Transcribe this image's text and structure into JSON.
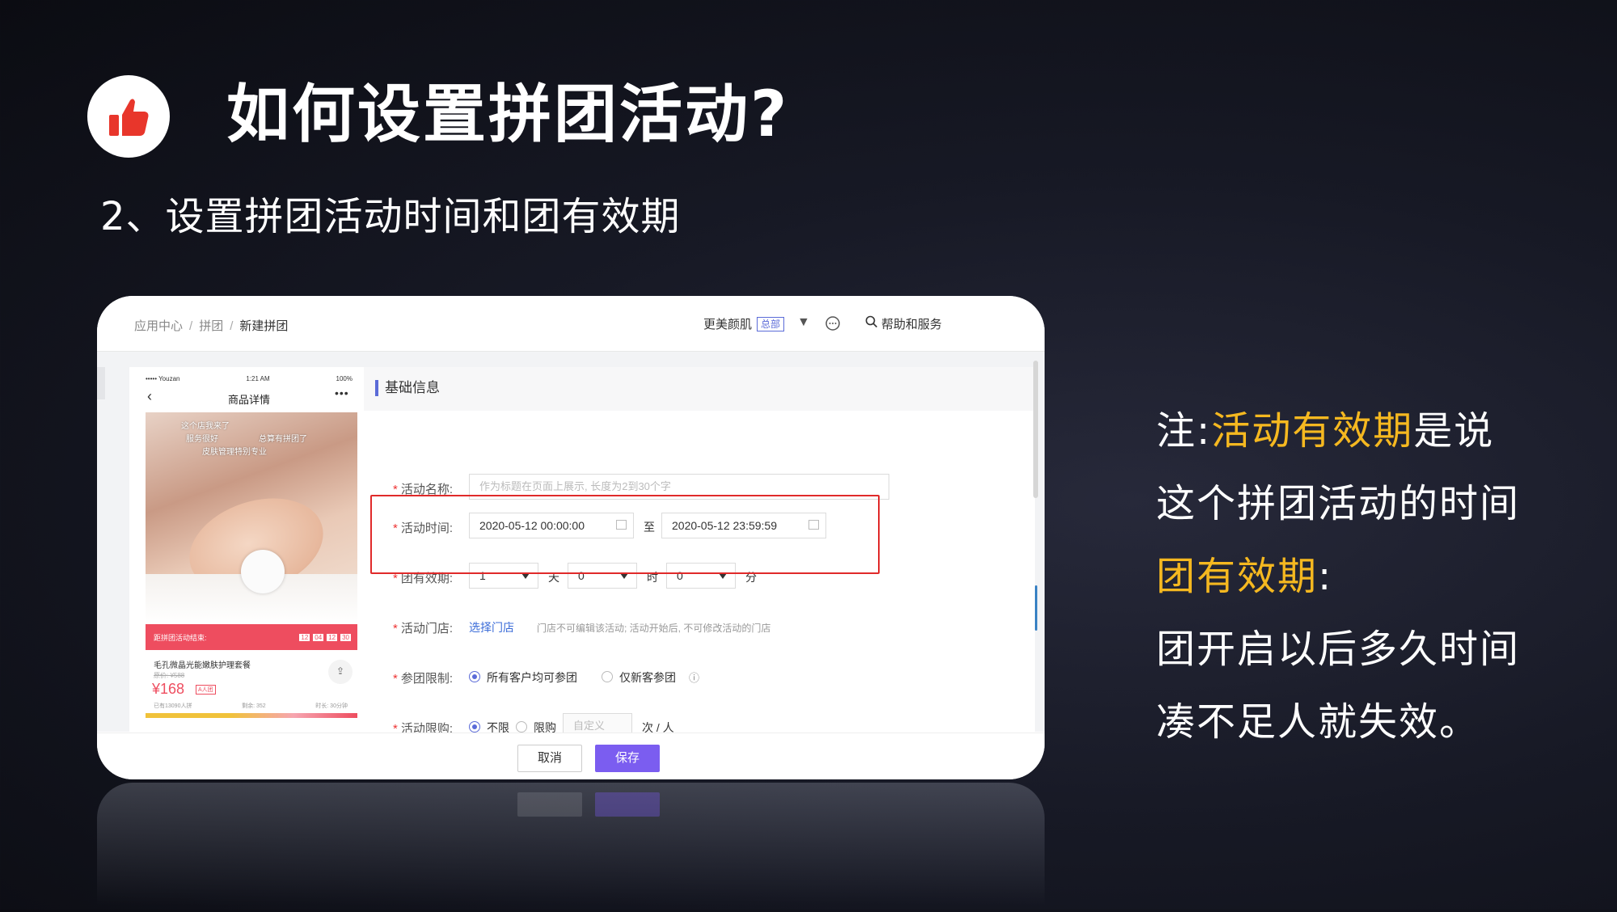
{
  "slide": {
    "title": "如何设置拼团活动?",
    "subtitle": "2、设置拼团活动时间和团有效期"
  },
  "colors": {
    "accent_red": "#e02a2a",
    "highlight": "#f5b820",
    "primary": "#7b5df0"
  },
  "topbar": {
    "breadcrumb": [
      "应用中心",
      "拼团",
      "新建拼团"
    ],
    "shop_name": "更美颜肌",
    "shop_badge": "总部",
    "help": "帮助和服务"
  },
  "preview": {
    "status_carrier": "••••• Youzan",
    "status_time": "1:21 AM",
    "status_battery": "100%",
    "title": "商品详情",
    "overlay1": "这个店我来了",
    "overlay2": "服务很好",
    "overlay3": "总算有拼团了",
    "overlay4": "皮肤管理特别专业",
    "countdown_label": "距拼团活动结束:",
    "countdown": [
      "12",
      "04",
      "12",
      "30"
    ],
    "product_name": "毛孔微晶光能嫩肤护理套餐",
    "original_price": "原价: ¥588",
    "price": "¥168",
    "tag": "A人团",
    "stat_joined": "已有13090人拼",
    "stat_left": "剩余: 352",
    "stat_time": "时长: 30分钟",
    "share": "分享"
  },
  "form": {
    "section_title": "基础信息",
    "name_label": "活动名称:",
    "name_placeholder": "作为标题在页面上展示, 长度为2到30个字",
    "time_label": "活动时间:",
    "start_time": "2020-05-12 00:00:00",
    "to": "至",
    "end_time": "2020-05-12 23:59:59",
    "validity_label": "团有效期:",
    "days_value": "1",
    "days_unit": "天",
    "hours_value": "0",
    "hours_unit": "时",
    "minutes_value": "0",
    "minutes_unit": "分",
    "store_label": "活动门店:",
    "store_link": "选择门店",
    "store_note": "门店不可编辑该活动; 活动开始后, 不可修改活动的门店",
    "limit_label": "参团限制:",
    "limit_opt1": "所有客户均可参团",
    "limit_opt2": "仅新客参团",
    "purchase_label": "活动限购:",
    "purchase_opt1": "不限",
    "purchase_opt2": "限购",
    "purchase_placeholder": "自定义",
    "purchase_unit": "次 / 人"
  },
  "footer": {
    "cancel": "取消",
    "save": "保存"
  },
  "note": {
    "prefix": "注:",
    "hl1": "活动有效期",
    "mid1": "是说",
    "line2": "这个拼团活动的时间",
    "hl2": "团有效期",
    "colon": ":",
    "line4": "团开启以后多久时间",
    "line5": "凑不足人就失效。"
  }
}
